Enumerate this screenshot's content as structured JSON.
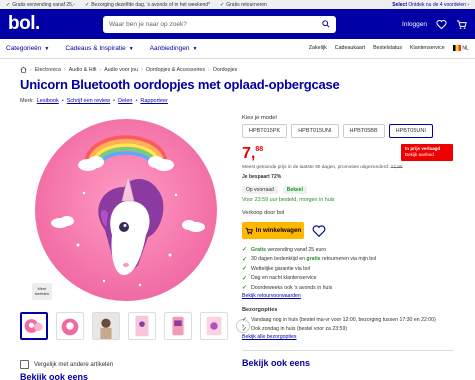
{
  "promo": {
    "item1": "Gratis verzending vanaf 25,-",
    "item2": "Bezorging dezelfde dag, 's avonds of in het weekend*",
    "item3": "Gratis retourneren",
    "select_prefix": "Select",
    "select_text": "Ontdek nu de 4 voordelen"
  },
  "header": {
    "logo": "bol.",
    "search_placeholder": "Waar ben je naar op zoek?",
    "login": "Inloggen"
  },
  "nav": {
    "categories": "Categorieën",
    "gifts": "Cadeaus & Inspiratie",
    "deals": "Aanbiedingen",
    "right": [
      "Zakelijk",
      "Cadeaukaart",
      "Bestelstatus",
      "Klantenservice"
    ],
    "lang": "NL"
  },
  "breadcrumb": [
    "Electronica",
    "Audio & Hifi",
    "Audio voor jou",
    "Oordopjes & Accessoires",
    "Oordopjes"
  ],
  "product": {
    "title": "Unicorn Bluetooth oordopjes met oplaad-opbergcase",
    "brand_label": "Merk:",
    "brand": "Lesibook",
    "write_review": "Schrijf een review",
    "share": "Delen",
    "report": "Rapporteer",
    "zoom_label_1": "Meer",
    "zoom_label_2": "beelden"
  },
  "model": {
    "label": "Kies je model",
    "options": [
      "HPBT015PK",
      "HPBT015UNI",
      "HPBT05BB",
      "HPBT05UNI"
    ]
  },
  "price": {
    "whole": "7,",
    "cents": "88",
    "badge_line1": "In prijs verlaagd",
    "badge_line2": "Bekijk aanbod",
    "lowest_text": "Meest getoonde prijs in de laatste 90 dagen, promoties uitgezonderd:",
    "lowest_value": "27,95",
    "save": "Je bespaart 72%"
  },
  "stock": {
    "tag1": "Op voorraad",
    "tag2": "Bekeel",
    "order_by": "Voor 23:59 uur besteld, morgen in huis",
    "seller": "Verkoop door bol"
  },
  "cart": {
    "label": "In winkelwagen"
  },
  "perks": [
    {
      "bold": "Gratis",
      "text": " verzending vanaf 25 euro"
    },
    {
      "bold": "",
      "text": "30 dagen bedenktijd en ",
      "bold2": "gratis",
      "text2": " retourneren via mijn bol"
    },
    {
      "bold": "",
      "text": "Wettelijke garantie via bol"
    },
    {
      "bold": "",
      "text": "Dag en nacht klantenservice"
    },
    {
      "bold": "",
      "text": "Doordeweeks ook 's avonds in huis"
    }
  ],
  "return_link": "Bekijk retourvoorwaarden",
  "delivery": {
    "title": "Bezorgopties",
    "options": [
      "Vandaag nog in huis (bestel ma-vr voor 12:00, bezorging tussen 17:30 en 22:00)",
      "Ook zondag in huis (bestel voor za 23:59)"
    ],
    "link": "Bekijk alle bezorgopties"
  },
  "compare": "Vergelijk met andere artikelen",
  "bekijk": "Bekijk ook eens",
  "bottom_title": "Bekijk ook eens"
}
